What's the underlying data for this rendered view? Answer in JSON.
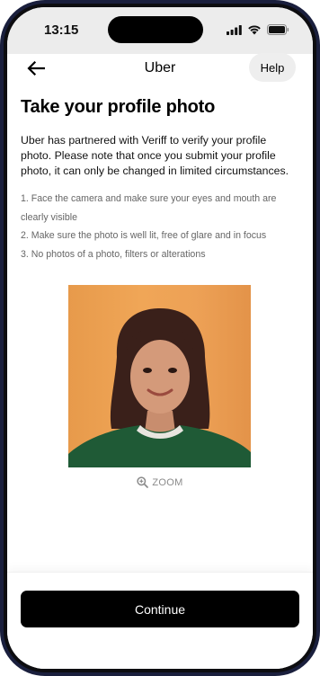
{
  "status_bar": {
    "time": "13:15",
    "icons": [
      "cellular-signal-icon",
      "wifi-icon",
      "battery-icon"
    ]
  },
  "nav": {
    "back_icon": "arrow-left-icon",
    "title": "Uber",
    "help_label": "Help"
  },
  "main": {
    "title": "Take your profile photo",
    "intro": "Uber has partnered with Veriff to verify your profile photo. Please note that once you submit your profile photo, it can only be changed in limited circumstances.",
    "steps": [
      "1. Face the camera and make sure your eyes and mouth are clearly visible",
      "2. Make sure the photo is well lit, free of glare and in focus",
      "3. No photos of a photo, filters or alterations"
    ],
    "zoom_label": "ZOOM"
  },
  "footer": {
    "continue_label": "Continue"
  },
  "colors": {
    "button": "#000000",
    "photo_background": "#ed9f53",
    "sweater": "#1f5a36"
  }
}
